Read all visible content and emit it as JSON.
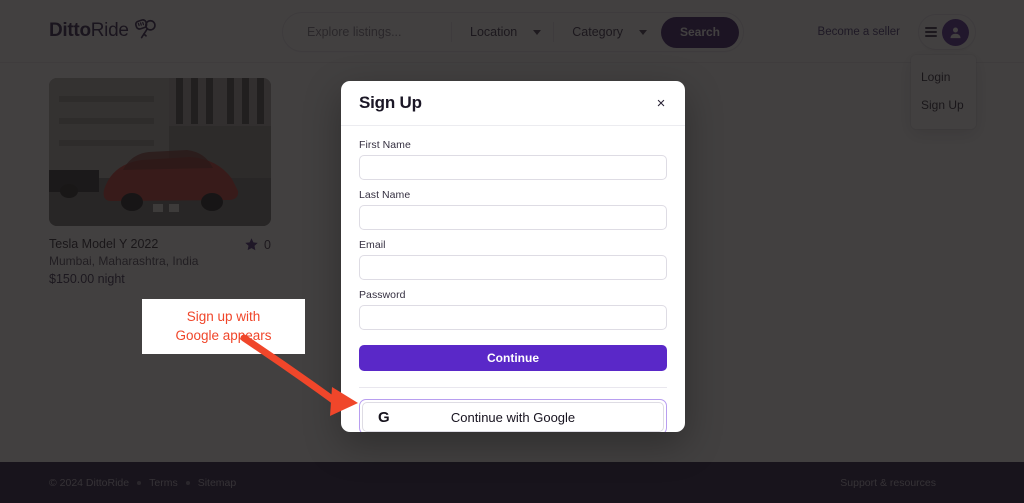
{
  "header": {
    "brand": {
      "strong": "Ditto",
      "light": "Ride",
      "icon": "car-key-icon"
    },
    "search": {
      "placeholder": "Explore listings...",
      "value": "",
      "location_label": "Location",
      "category_label": "Category",
      "search_button": "Search"
    },
    "become_seller": "Become a seller",
    "account_menu": {
      "items": [
        {
          "label": "Login"
        },
        {
          "label": "Sign Up"
        }
      ]
    }
  },
  "listing": {
    "title": "Tesla Model Y 2022",
    "location": "Mumbai, Maharashtra, India",
    "price": "$150.00 night",
    "rating_count": "0"
  },
  "modal": {
    "title": "Sign Up",
    "close_label": "×",
    "fields": [
      {
        "label": "First Name",
        "value": "",
        "placeholder": ""
      },
      {
        "label": "Last Name",
        "value": "",
        "placeholder": ""
      },
      {
        "label": "Email",
        "value": "",
        "placeholder": ""
      },
      {
        "label": "Password",
        "value": "",
        "placeholder": ""
      }
    ],
    "continue_label": "Continue",
    "google_label": "Continue with Google",
    "google_mark": "G"
  },
  "annotation": {
    "line1": "Sign up with",
    "line2": "Google appears",
    "color": "#f0462a"
  },
  "footer": {
    "copyright": "© 2024 DittoRide",
    "terms": "Terms",
    "sitemap": "Sitemap",
    "support": "Support & resources"
  },
  "colors": {
    "brand_purple": "#4b1d91",
    "primary_button": "#5a28c8",
    "search_button": "#2d0e5f",
    "footer_bg": "#1b0e37",
    "annotation_red": "#f0462a",
    "google_highlight": "#b89ef0"
  }
}
